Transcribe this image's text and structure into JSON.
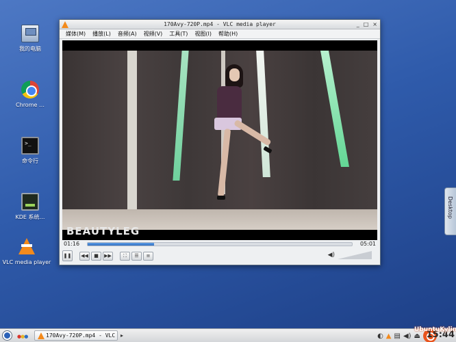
{
  "desktop": {
    "icons": [
      {
        "label": "我的电脑",
        "icon": "computer-icon"
      },
      {
        "label": "Chrome …",
        "icon": "chrome-icon"
      },
      {
        "label": "命令行",
        "icon": "terminal-icon"
      },
      {
        "label": "KDE 系统…",
        "icon": "kde-system-icon"
      },
      {
        "label": "VLC media player",
        "icon": "vlc-icon"
      }
    ],
    "side_tab": "Desktop"
  },
  "vlc": {
    "title": "170Avy-720P.mp4 - VLC media player",
    "window_buttons": [
      "_",
      "□",
      "×"
    ],
    "menu": [
      "媒体(M)",
      "播放(L)",
      "音频(A)",
      "视频(V)",
      "工具(T)",
      "视图(I)",
      "帮助(H)"
    ],
    "watermark": "BEAUTYLEG",
    "elapsed": "01:16",
    "total": "05:01",
    "progress": 0.25,
    "volume": 0.0,
    "controls": [
      "pause",
      "prev",
      "stop",
      "next",
      "fullscreen",
      "extended",
      "playlist"
    ]
  },
  "taskbar": {
    "task_label": "170Avy-720P.mp4 - VLC media",
    "clock": "15:44",
    "brand": "UbuntuKylin"
  },
  "colors": {
    "accent": "#2f6fc2",
    "vlc_orange": "#f38a1c",
    "brand_orange": "#e9541d"
  }
}
